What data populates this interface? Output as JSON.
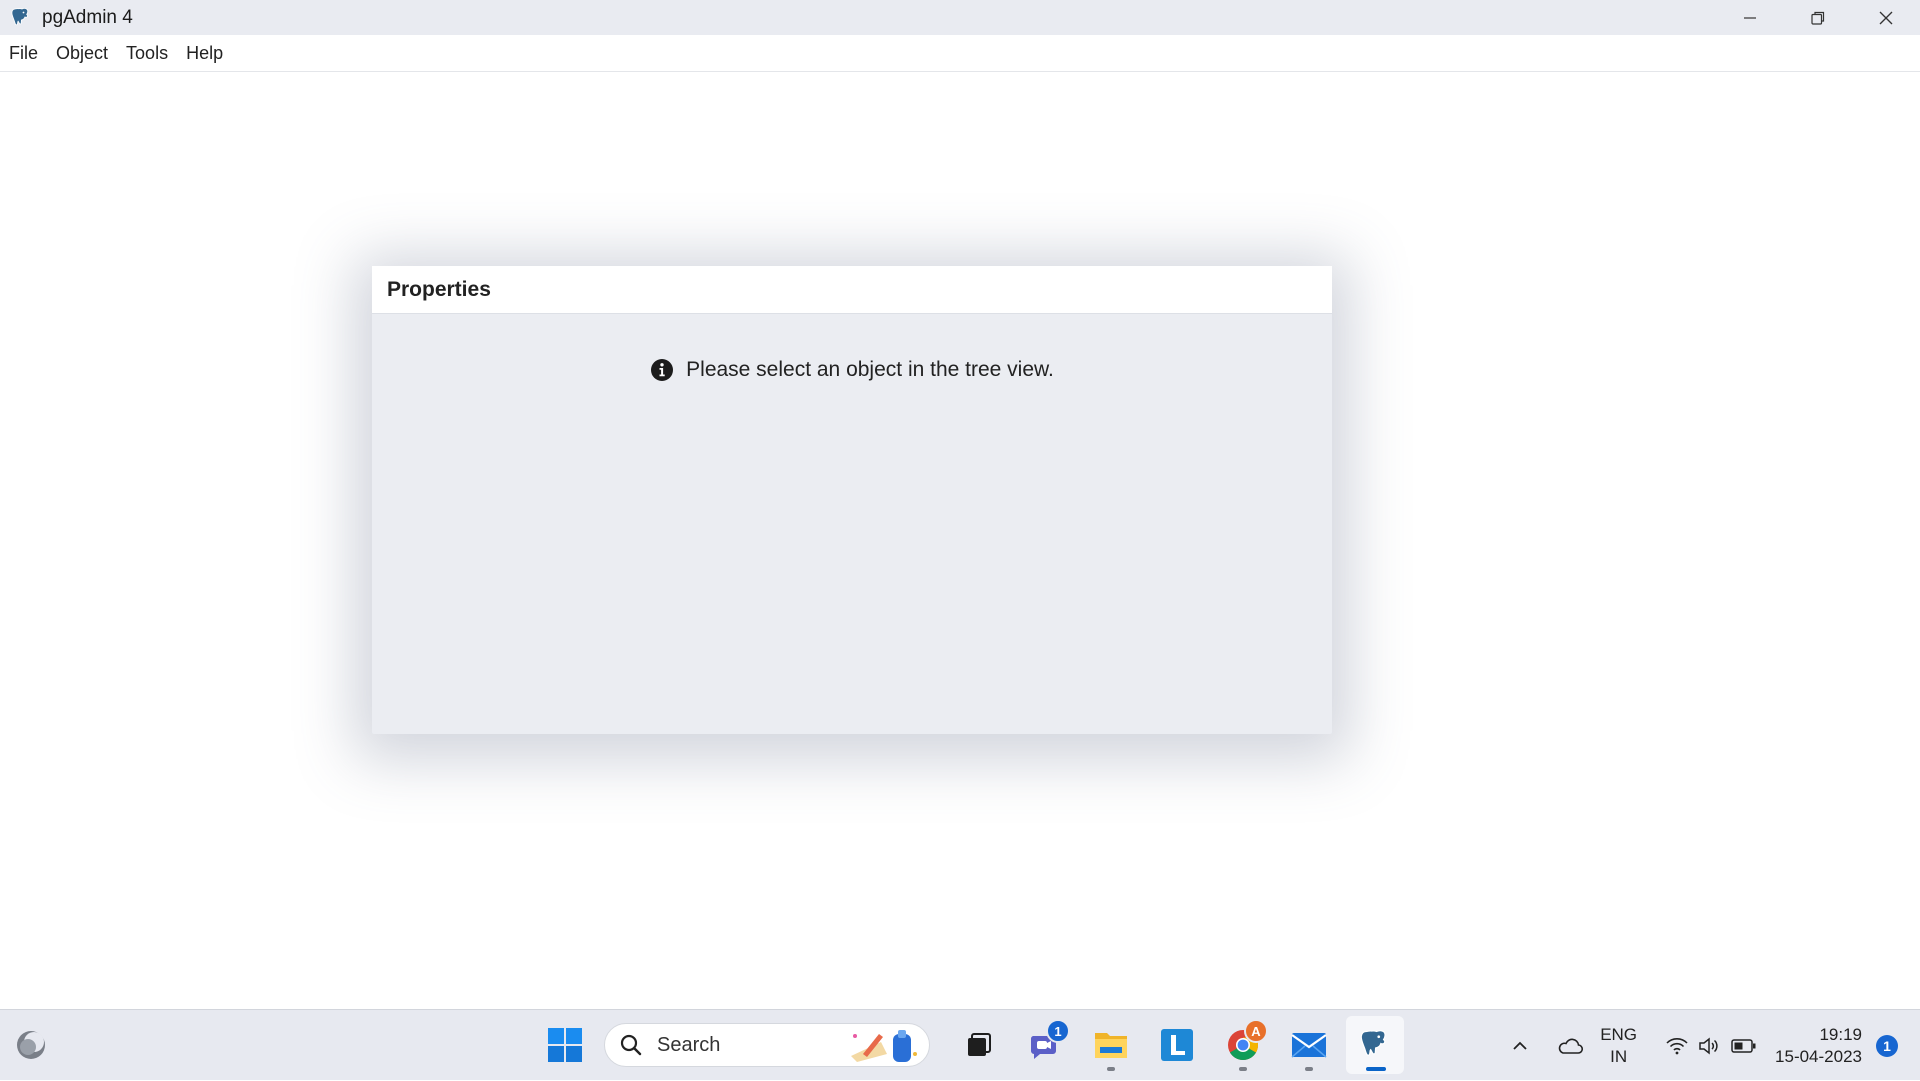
{
  "window": {
    "title": "pgAdmin 4"
  },
  "menubar": {
    "items": [
      {
        "label": "File"
      },
      {
        "label": "Object"
      },
      {
        "label": "Tools"
      },
      {
        "label": "Help"
      }
    ]
  },
  "panel": {
    "title": "Properties",
    "message": "Please select an object in the tree view."
  },
  "taskbar": {
    "search_placeholder": "Search",
    "apps": [
      {
        "name": "start-icon"
      },
      {
        "name": "search-box"
      },
      {
        "name": "task-view-icon"
      },
      {
        "name": "teams-chat-icon",
        "badge": "1"
      },
      {
        "name": "file-explorer-icon"
      },
      {
        "name": "l-app-icon"
      },
      {
        "name": "chrome-icon",
        "badge": "A"
      },
      {
        "name": "mail-icon"
      },
      {
        "name": "pgadmin-icon"
      }
    ],
    "tray": {
      "lang_line1": "ENG",
      "lang_line2": "IN",
      "time": "19:19",
      "date": "15-04-2023",
      "notifications": "1"
    }
  },
  "colors": {
    "accent": "#1766d1",
    "panel_bg": "#ebedf2",
    "titlebar_bg": "#e9ebf1",
    "taskbar_bg": "#e7e9f0"
  }
}
